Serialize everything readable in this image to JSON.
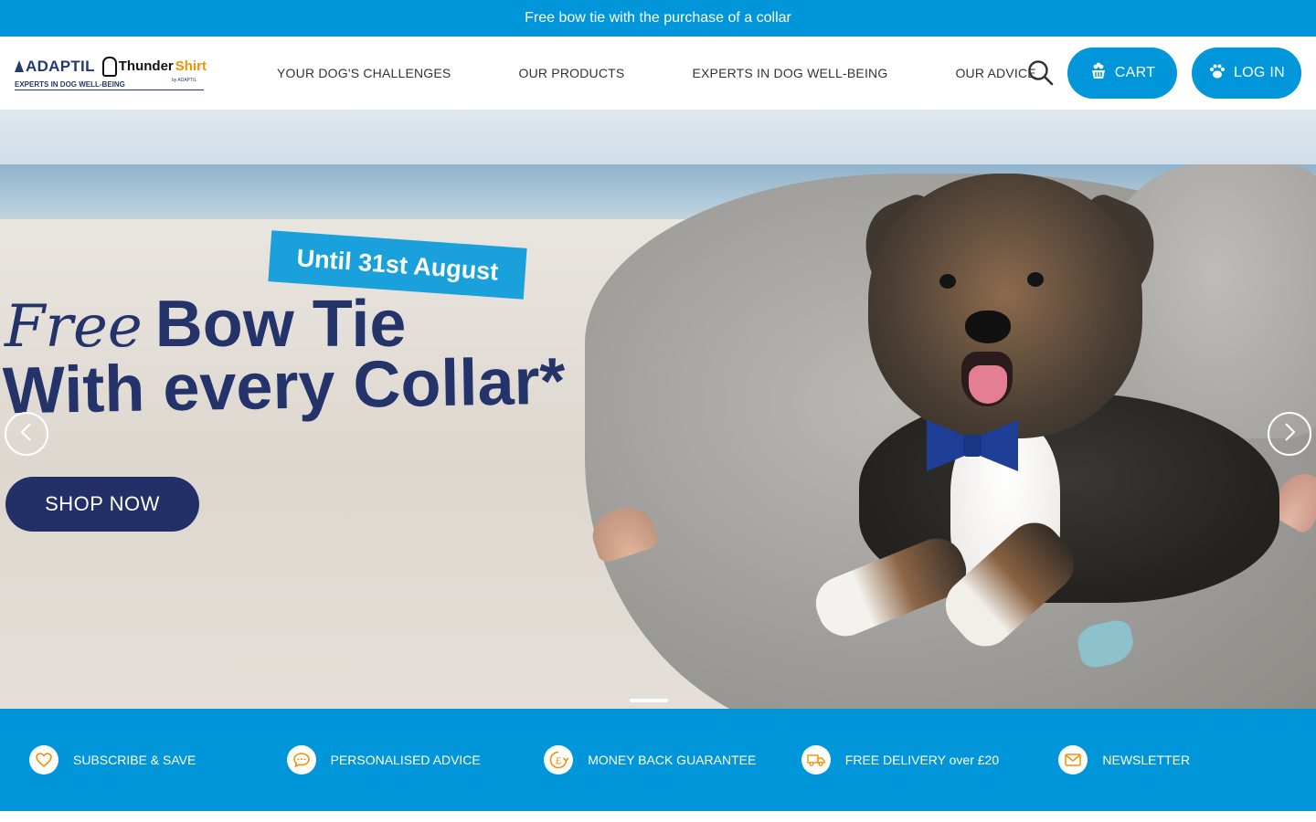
{
  "promo": {
    "text": "Free bow tie with the purchase of a collar"
  },
  "logo": {
    "brand_1": "ADAPTIL",
    "brand_2_a": "Thunder",
    "brand_2_b": "Shirt",
    "brand_2_by": "by ADAPTIL",
    "tagline": "EXPERTS IN DOG WELL-BEING"
  },
  "nav": {
    "items": [
      {
        "label": "YOUR DOG'S CHALLENGES"
      },
      {
        "label": "OUR PRODUCTS"
      },
      {
        "label": "EXPERTS IN DOG WELL-BEING"
      },
      {
        "label": "OUR ADVICE"
      }
    ]
  },
  "header": {
    "search_icon": "search-icon",
    "cart_label": "CART",
    "login_label": "LOG IN"
  },
  "hero": {
    "date_badge": "Until 31st August",
    "headline_free": "Free",
    "headline_bowtie": "Bow Tie",
    "headline_line2": "With every Collar*",
    "cta": "SHOP NOW",
    "slide_index": 1
  },
  "benefits": {
    "items": [
      {
        "label": "SUBSCRIBE & SAVE",
        "icon": "heart-icon"
      },
      {
        "label": "PERSONALISED ADVICE",
        "icon": "chat-icon"
      },
      {
        "label": "MONEY BACK GUARANTEE",
        "icon": "pound-icon"
      },
      {
        "label": "FREE DELIVERY over £20",
        "icon": "delivery-truck-icon"
      },
      {
        "label": "NEWSLETTER",
        "icon": "mail-icon"
      }
    ]
  },
  "colors": {
    "brand_blue": "#0096d9",
    "navy": "#233068",
    "accent_orange": "#f39200"
  }
}
